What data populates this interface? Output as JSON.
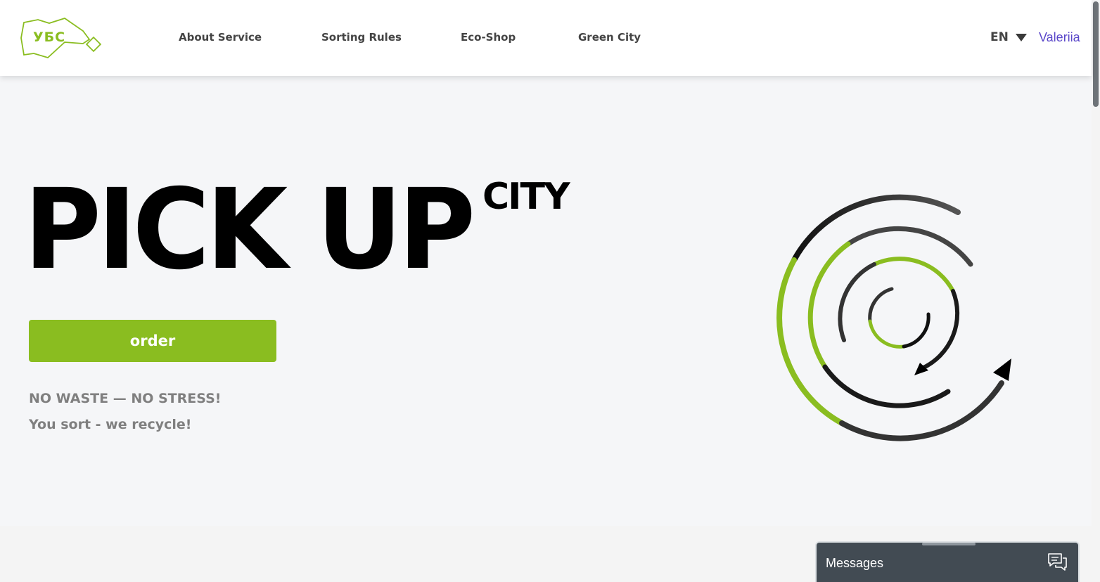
{
  "header": {
    "logo_text": "УБС",
    "nav": [
      "About Service",
      "Sorting Rules",
      "Eco-Shop",
      "Green City"
    ],
    "language": "EN",
    "user_name": "Valeriia"
  },
  "hero": {
    "title": "PICK UP",
    "title_sup": "CITY",
    "order_label": "order",
    "slogan_line1": "NO WASTE — NO STRESS!",
    "slogan_line2": "You sort - we recycle!"
  },
  "chat": {
    "label": "Messages"
  },
  "colors": {
    "brand_green": "#8abd20",
    "user_link": "#5a47c9",
    "chat_bar": "#424b53"
  },
  "icons": {
    "language_caret": "triangle-down",
    "messages": "chat-bubbles"
  }
}
